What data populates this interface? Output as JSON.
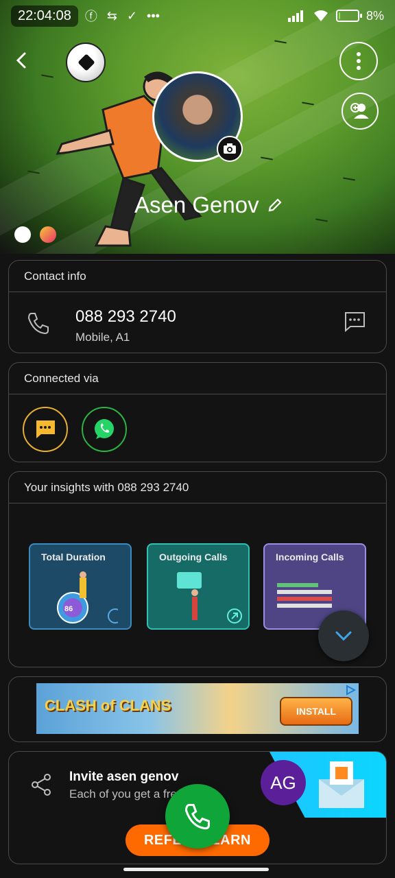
{
  "status_bar": {
    "time": "22:04:08",
    "battery_text": "8%",
    "battery_level": 0.08,
    "icons": [
      "facebook-icon",
      "cast-icon",
      "check-icon",
      "more-icon"
    ]
  },
  "profile": {
    "name": "Asen Genov",
    "initials": "AG"
  },
  "contact_info": {
    "heading": "Contact info",
    "phone": "088 293 2740",
    "phone_type": "Mobile, A1"
  },
  "connected_via": {
    "heading": "Connected via",
    "apps": [
      "sms-app",
      "whatsapp"
    ]
  },
  "insights": {
    "heading": "Your insights with 088 293 2740",
    "cards": [
      {
        "title": "Total Duration",
        "value": "86",
        "color": "#2f6fa3"
      },
      {
        "title": "Outgoing Calls",
        "color": "#1ea89b"
      },
      {
        "title": "Incoming Calls",
        "color": "#6e5aa8"
      }
    ]
  },
  "ad": {
    "brand": "CLASH of CLANS",
    "cta": "INSTALL"
  },
  "invite": {
    "title": "Invite asen genov",
    "subtitle": "Each of you get a fre",
    "button": "REFER & EARN"
  },
  "colors": {
    "accent_green": "#10a539",
    "accent_orange": "#ff6a00",
    "card_border": "#4a4a4a",
    "background": "#131313"
  }
}
